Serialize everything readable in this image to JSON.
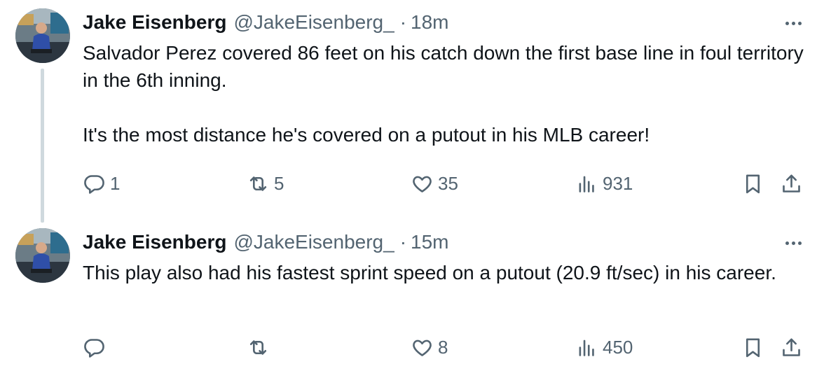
{
  "tweets": [
    {
      "author": {
        "name": "Jake Eisenberg",
        "handle": "@JakeEisenberg_",
        "time": "18m"
      },
      "text": [
        "Salvador Perez covered 86 feet on his catch down the first base line in foul territory in the 6th inning.",
        "It's the most distance he's covered on a putout in his MLB career!"
      ],
      "stats": {
        "replies": "1",
        "reposts": "5",
        "likes": "35",
        "views": "931"
      }
    },
    {
      "author": {
        "name": "Jake Eisenberg",
        "handle": "@JakeEisenberg_",
        "time": "15m"
      },
      "text": [
        "This play also had his fastest sprint speed on a putout (20.9 ft/sec) in his career."
      ],
      "stats": {
        "replies": "",
        "reposts": "",
        "likes": "8",
        "views": "450"
      }
    }
  ],
  "separator": "·",
  "icons": {
    "reply": "reply-icon",
    "repost": "repost-icon",
    "like": "heart-icon",
    "views": "views-icon",
    "bookmark": "bookmark-icon",
    "share": "share-icon",
    "more": "more-icon"
  },
  "colors": {
    "text": "#0f1419",
    "secondary": "#536471",
    "thread_line": "#cfd9de"
  }
}
